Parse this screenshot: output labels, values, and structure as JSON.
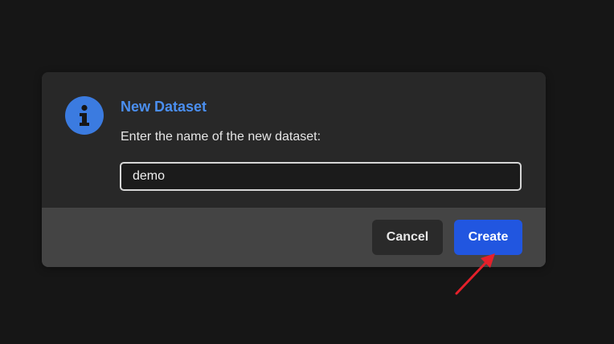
{
  "dialog": {
    "title": "New Dataset",
    "prompt": "Enter the name of the new dataset:",
    "input_value": "demo",
    "cancel_label": "Cancel",
    "create_label": "Create",
    "icon": "info-icon"
  },
  "colors": {
    "accent": "#4b8ff0",
    "primary_button": "#2156e0",
    "annotation_arrow": "#e5202a"
  }
}
